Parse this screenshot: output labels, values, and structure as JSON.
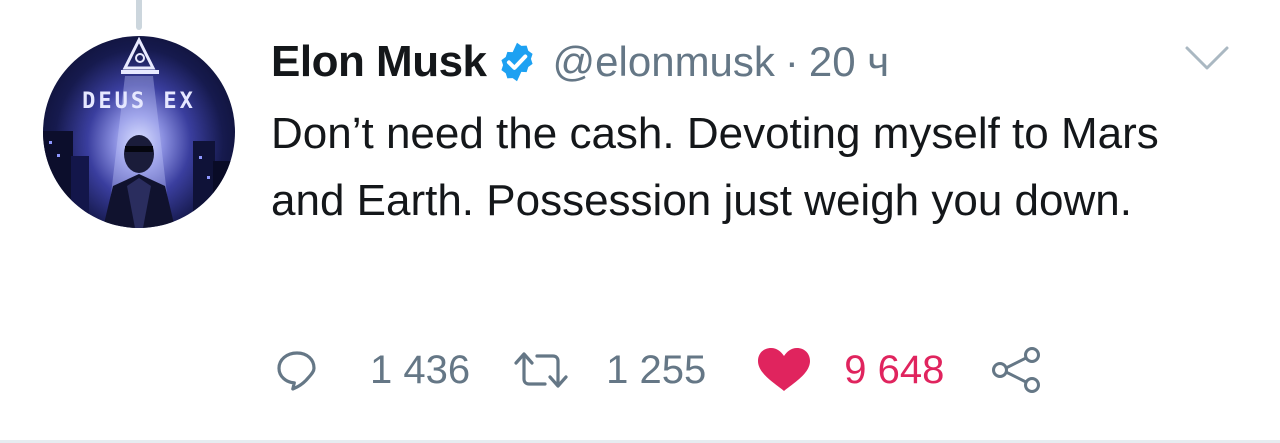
{
  "tweet": {
    "author_name": "Elon Musk",
    "verified": true,
    "handle": "@elonmusk",
    "separator": "·",
    "timestamp": "20 ч",
    "text": "Don’t need the cash. Devoting myself to Mars and Earth. Possession just weigh you down.",
    "avatar": {
      "description_icon": "deus-ex-avatar",
      "logo_text": "DEUS EX"
    },
    "actions": {
      "replies": "1 436",
      "retweets": "1 255",
      "likes": "9 648",
      "liked": true
    }
  },
  "icons": {
    "verified": "verified-badge-icon",
    "menu": "chevron-down-icon",
    "reply": "reply-bubble-icon",
    "retweet": "retweet-icon",
    "like": "heart-icon",
    "share": "share-icon"
  },
  "colors": {
    "text_primary": "#14171a",
    "text_secondary": "#657786",
    "verified_blue": "#1da1f2",
    "like_red": "#e0245e",
    "divider": "#e6ecf0"
  }
}
